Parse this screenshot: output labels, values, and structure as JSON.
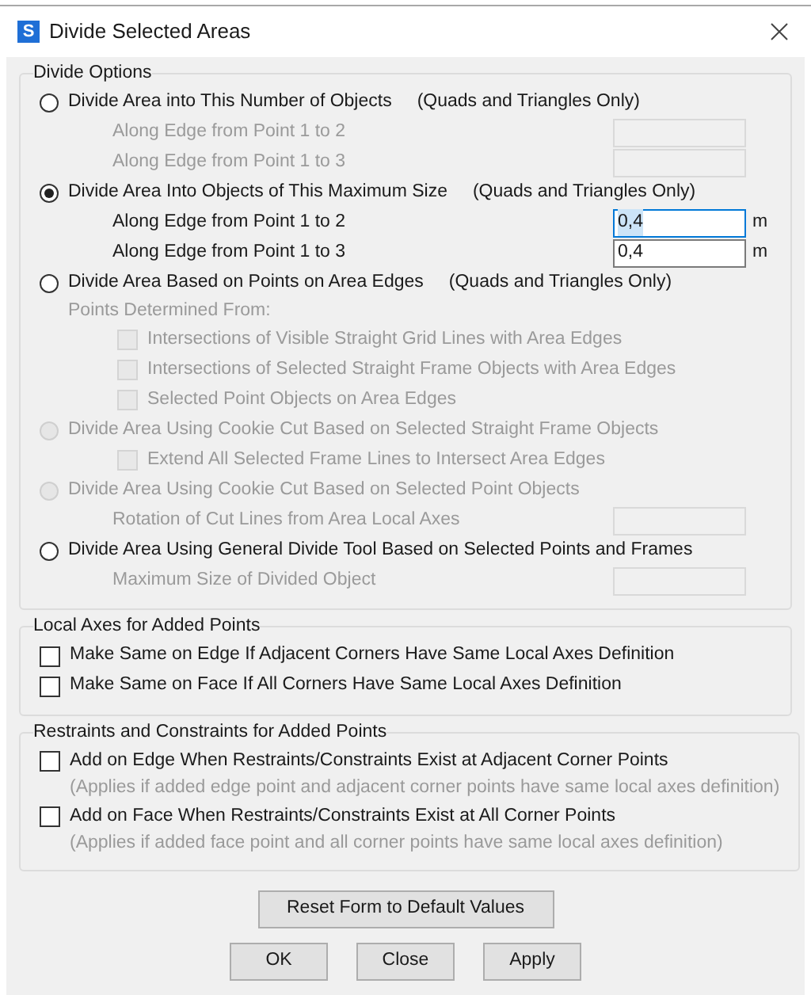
{
  "window": {
    "title": "Divide Selected Areas",
    "icon_letter": "S"
  },
  "divide_options": {
    "title": "Divide Options",
    "options": [
      {
        "label": "Divide Area into This Number of Objects",
        "note": "(Quads and Triangles Only)",
        "selected": false,
        "disabled": false,
        "rows": [
          {
            "kind": "field",
            "label": "Along Edge from Point 1 to 2",
            "disabled": true,
            "focused": false
          },
          {
            "kind": "field",
            "label": "Along Edge from Point 1 to 3",
            "disabled": true,
            "focused": false
          }
        ]
      },
      {
        "label": "Divide Area Into Objects of This Maximum Size",
        "note": "(Quads and Triangles Only)",
        "selected": true,
        "disabled": false,
        "rows": [
          {
            "kind": "field",
            "label": "Along Edge from Point 1 to 2",
            "value": "0,4",
            "unit": "m",
            "disabled": false,
            "focused": true
          },
          {
            "kind": "field",
            "label": "Along Edge from Point 1 to 3",
            "value": "0,4",
            "unit": "m",
            "disabled": false,
            "focused": false
          }
        ]
      },
      {
        "label": "Divide Area Based on Points on Area Edges",
        "note": "(Quads and Triangles Only)",
        "selected": false,
        "disabled": false,
        "rows": [
          {
            "kind": "text",
            "label": "Points Determined From:",
            "disabled": true
          },
          {
            "kind": "checkbox",
            "label": "Intersections of Visible Straight Grid Lines with Area Edges",
            "checked": false,
            "disabled": true
          },
          {
            "kind": "checkbox",
            "label": "Intersections of Selected Straight Frame Objects with Area Edges",
            "checked": false,
            "disabled": true
          },
          {
            "kind": "checkbox",
            "label": "Selected Point Objects on Area Edges",
            "checked": false,
            "disabled": true
          }
        ]
      },
      {
        "label": "Divide Area Using Cookie Cut Based on Selected Straight Frame Objects",
        "selected": false,
        "disabled": true,
        "rows": [
          {
            "kind": "checkbox",
            "label": "Extend All Selected Frame Lines to Intersect Area Edges",
            "checked": false,
            "disabled": true
          }
        ]
      },
      {
        "label": "Divide Area Using Cookie Cut Based on Selected Point Objects",
        "selected": false,
        "disabled": true,
        "rows": [
          {
            "kind": "field",
            "label": "Rotation of Cut Lines from Area Local Axes",
            "disabled": true,
            "focused": false
          }
        ]
      },
      {
        "label": "Divide Area Using General Divide Tool Based on Selected Points and Frames",
        "selected": false,
        "disabled": false,
        "rows": [
          {
            "kind": "field",
            "label": "Maximum Size of Divided Object",
            "disabled": true,
            "focused": false
          }
        ]
      }
    ]
  },
  "local_axes": {
    "title": "Local Axes for Added Points",
    "checkboxes": [
      {
        "label": "Make Same on Edge If Adjacent Corners Have Same Local Axes Definition",
        "checked": false
      },
      {
        "label": "Make Same on Face If All Corners Have Same Local Axes Definition",
        "checked": false
      }
    ]
  },
  "restraints": {
    "title": "Restraints and Constraints for Added Points",
    "checkboxes": [
      {
        "label": "Add on Edge When Restraints/Constraints Exist at Adjacent Corner Points",
        "note": "(Applies if added edge point and adjacent corner points have same local axes definition)",
        "checked": false
      },
      {
        "label": "Add on Face When Restraints/Constraints Exist at All Corner Points",
        "note": "(Applies if added face point and all corner points have same local axes definition)",
        "checked": false
      }
    ]
  },
  "reset_button": "Reset Form to Default Values",
  "buttons": [
    "OK",
    "Close",
    "Apply"
  ]
}
